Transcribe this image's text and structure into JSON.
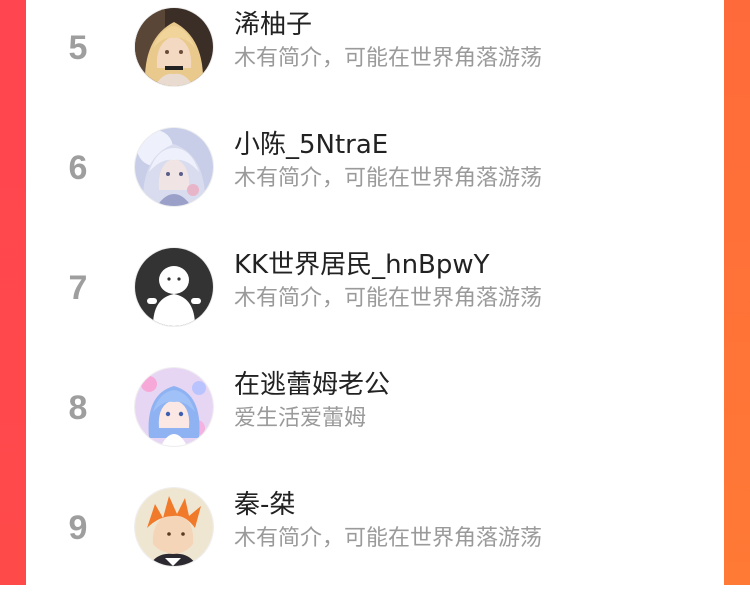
{
  "theme": {
    "left_edge_color": "#ff4550",
    "right_edge_color": "#ff7a35",
    "rank_color": "#9e9e9e",
    "name_color": "#222222",
    "bio_color": "#9a9a9a"
  },
  "ranking": {
    "items": [
      {
        "rank": "5",
        "name": "浠柚子",
        "bio": "木有简介，可能在世界角落游荡",
        "avatar_icon": "anime-blonde-girl-avatar"
      },
      {
        "rank": "6",
        "name": "小陈_5NtraE",
        "bio": "木有简介，可能在世界角落游荡",
        "avatar_icon": "anime-silver-hair-avatar"
      },
      {
        "rank": "7",
        "name": "KK世界居民_hnBpwY",
        "bio": "木有简介，可能在世界角落游荡",
        "avatar_icon": "default-white-figure-avatar"
      },
      {
        "rank": "8",
        "name": "在逃蕾姆老公",
        "bio": "爱生活爱蕾姆",
        "avatar_icon": "anime-rem-avatar"
      },
      {
        "rank": "9",
        "name": "秦-桀",
        "bio": "木有简介，可能在世界角落游荡",
        "avatar_icon": "anime-orange-hair-boy-avatar"
      }
    ]
  }
}
